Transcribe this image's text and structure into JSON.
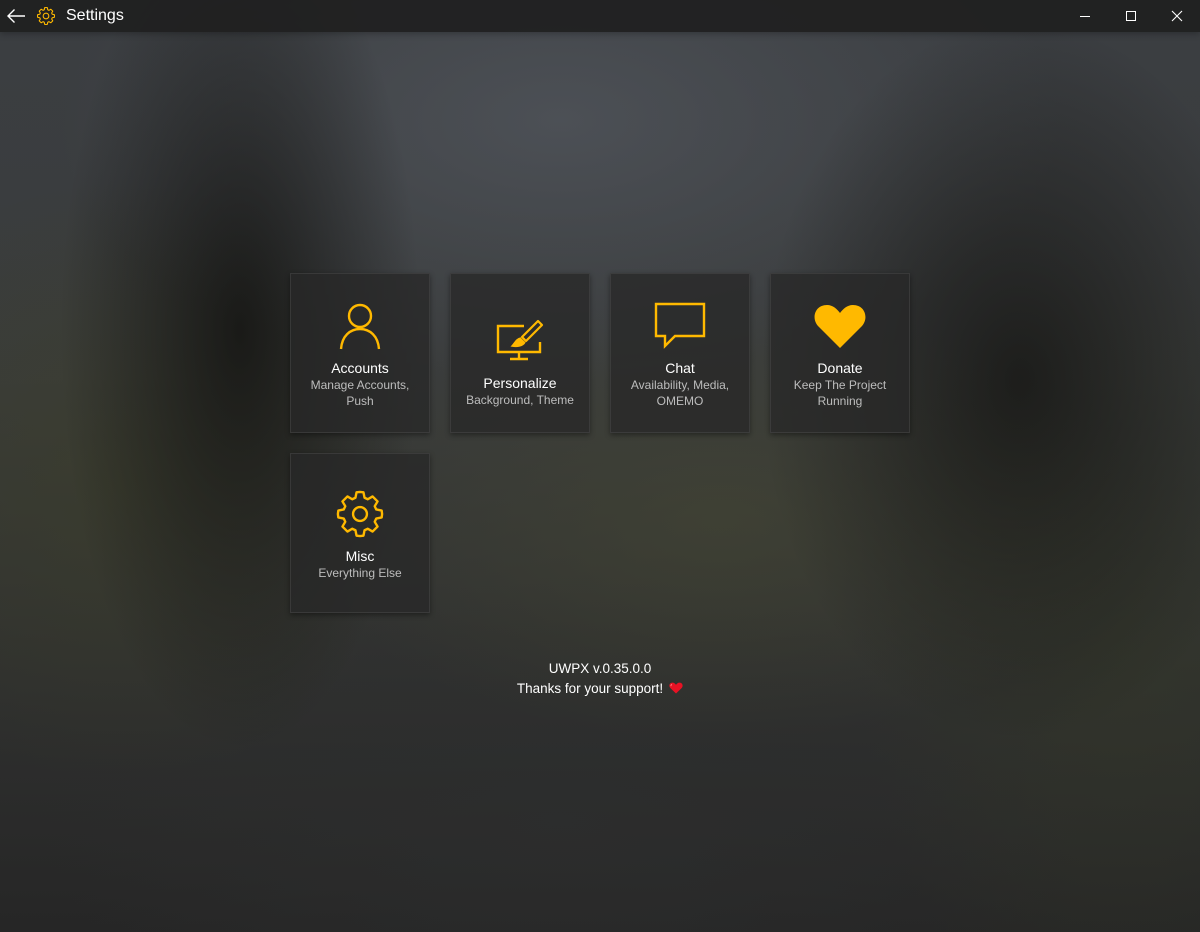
{
  "window": {
    "title": "Settings"
  },
  "colors": {
    "accent": "#FFB900",
    "heart": "#E81224"
  },
  "titlebar_icons": {
    "back": "back-arrow-icon",
    "app": "gear-icon",
    "minimize": "minimize-icon",
    "maximize": "maximize-icon",
    "close": "close-icon"
  },
  "tiles": [
    {
      "title": "Accounts",
      "subtitle": "Manage Accounts, Push",
      "icon": "person-icon"
    },
    {
      "title": "Personalize",
      "subtitle": "Background, Theme",
      "icon": "paintbrush-monitor-icon"
    },
    {
      "title": "Chat",
      "subtitle": "Availability, Media, OMEMO",
      "icon": "chat-bubble-icon"
    },
    {
      "title": "Donate",
      "subtitle": "Keep The Project Running",
      "icon": "heart-icon"
    },
    {
      "title": "Misc",
      "subtitle": "Everything Else",
      "icon": "gear-icon"
    }
  ],
  "footer": {
    "version": "UWPX v.0.35.0.0",
    "thanks": "Thanks for your support!",
    "emoji": "red-heart-icon"
  }
}
